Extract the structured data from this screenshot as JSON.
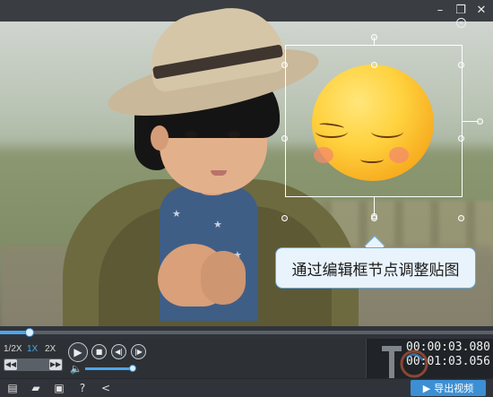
{
  "window": {
    "title": "",
    "controls": {
      "minimize": "–",
      "restore": "❐",
      "close": "✕"
    }
  },
  "preview": {
    "sticker": {
      "type": "emoji",
      "icon": "smiling-face-emoji"
    },
    "frame_close": "×",
    "tooltip": "通过编辑框节点调整贴图"
  },
  "playback": {
    "speeds": [
      "1/2X",
      "1X",
      "2X"
    ],
    "active_speed": "1X",
    "progress": 0.06,
    "volume": 0.95,
    "current_time": "00:00:03.080",
    "total_time": "00:01:03.056",
    "step_back": "◀◀",
    "step_forward": "▶▶"
  },
  "toolbar": {
    "export_label": "导出视频"
  },
  "colors": {
    "accent": "#4ea6ea",
    "tooltip_bg": "#e9f3fb",
    "panel": "#2d3136"
  }
}
